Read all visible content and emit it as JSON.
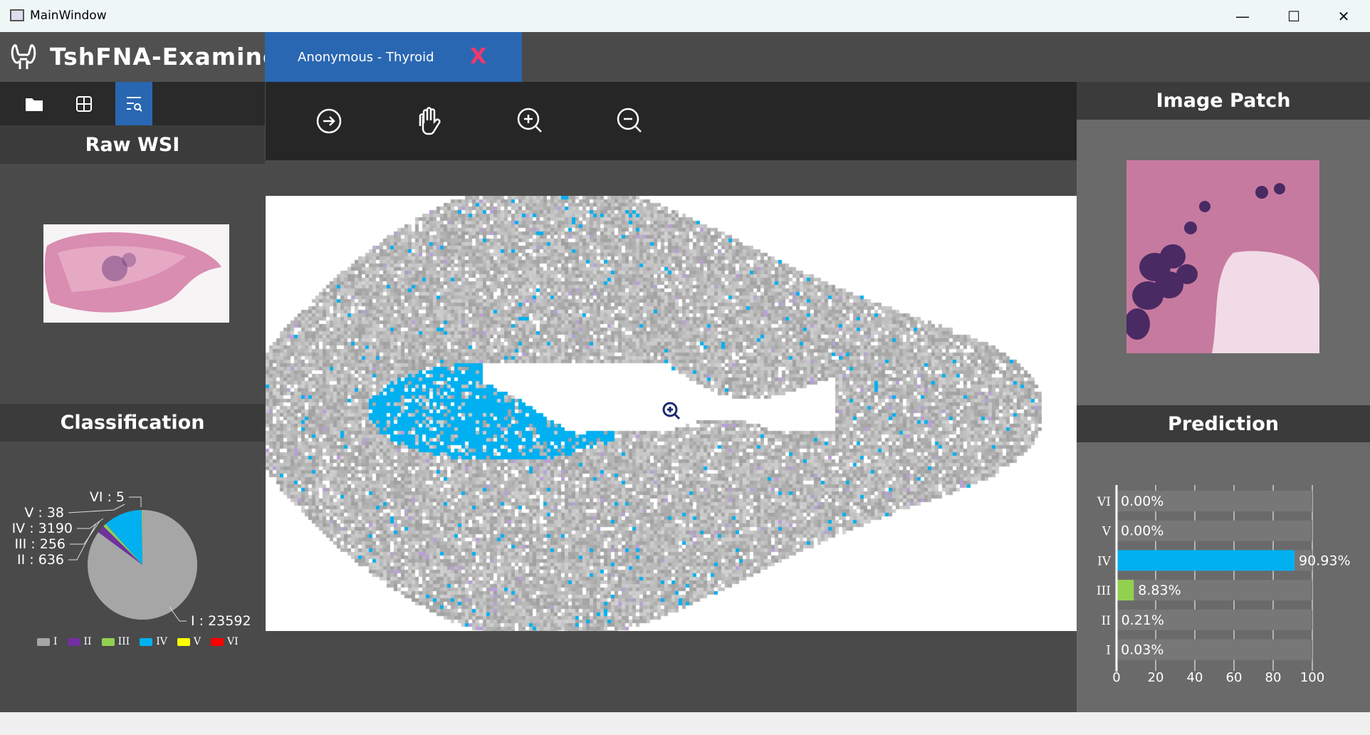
{
  "window": {
    "title": "MainWindow",
    "min": "—",
    "max": "☐",
    "close": "✕"
  },
  "app": {
    "name": "TshFNA-Examiner"
  },
  "tab": {
    "label": "Anonymous - Thyroid",
    "close": "X"
  },
  "left": {
    "raw_header": "Raw  WSI",
    "class_header": "Classification"
  },
  "right": {
    "patch_header": "Image  Patch",
    "pred_header": "Prediction"
  },
  "colors": {
    "I": "#a6a6a6",
    "II": "#7030a0",
    "III": "#92d050",
    "IV": "#00b0f0",
    "V": "#ffff00",
    "VI": "#ff0000",
    "accent": "#2a67b2"
  },
  "chart_data": [
    {
      "type": "pie",
      "title": "Classification",
      "categories": [
        "I",
        "II",
        "III",
        "IV",
        "V",
        "VI"
      ],
      "values": [
        23592,
        636,
        256,
        3190,
        38,
        5
      ],
      "labels": [
        "I : 23592",
        "II : 636",
        "III : 256",
        "IV : 3190",
        "V : 38",
        "VI : 5"
      ],
      "legend": [
        "I",
        "II",
        "III",
        "IV",
        "V",
        "VI"
      ],
      "legend_position": "bottom"
    },
    {
      "type": "bar",
      "orientation": "horizontal",
      "title": "Prediction",
      "categories": [
        "VI",
        "V",
        "IV",
        "III",
        "II",
        "I"
      ],
      "values": [
        0.0,
        0.0,
        90.93,
        8.83,
        0.21,
        0.03
      ],
      "value_labels": [
        "0.00%",
        "0.00%",
        "90.93%",
        "8.83%",
        "0.21%",
        "0.03%"
      ],
      "xlim": [
        0,
        100
      ],
      "xticks": [
        "0",
        "20",
        "40",
        "60",
        "80",
        "100"
      ],
      "grid": true
    }
  ]
}
